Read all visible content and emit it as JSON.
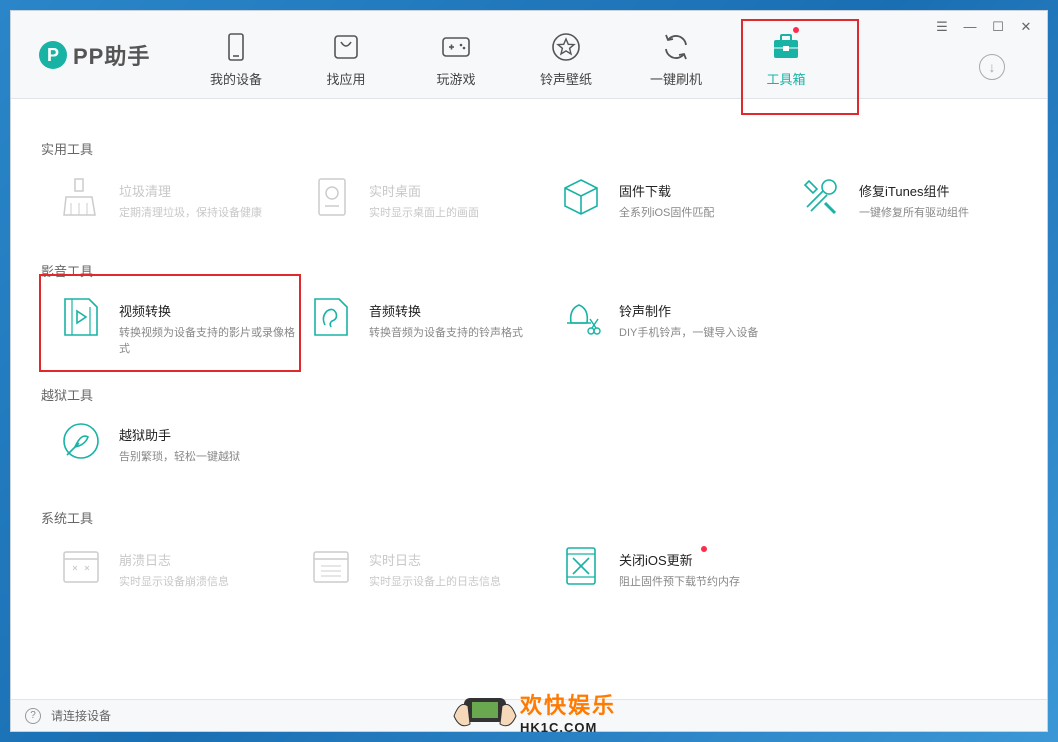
{
  "app": {
    "logo_mark": "P",
    "logo_text": "PP助手"
  },
  "nav": {
    "items": [
      {
        "label": "我的设备",
        "icon": "phone-icon"
      },
      {
        "label": "找应用",
        "icon": "bag-icon"
      },
      {
        "label": "玩游戏",
        "icon": "gamepad-icon"
      },
      {
        "label": "铃声壁纸",
        "icon": "star-icon"
      },
      {
        "label": "一键刷机",
        "icon": "refresh-icon"
      },
      {
        "label": "工具箱",
        "icon": "toolbox-icon",
        "active": true
      }
    ]
  },
  "window_controls": {
    "menu": "☰",
    "minimize": "—",
    "maximize": "☐",
    "close": "✕"
  },
  "download_icon": "↓",
  "sections": {
    "practical": {
      "title": "实用工具",
      "tools": [
        {
          "name": "垃圾清理",
          "desc": "定期清理垃圾，保持设备健康",
          "icon": "brush-icon",
          "disabled": true
        },
        {
          "name": "实时桌面",
          "desc": "实时显示桌面上的画面",
          "icon": "desktop-icon",
          "disabled": true
        },
        {
          "name": "固件下载",
          "desc": "全系列iOS固件匹配",
          "icon": "cube-icon"
        },
        {
          "name": "修复iTunes组件",
          "desc": "一键修复所有驱动组件",
          "icon": "wrench-icon"
        }
      ]
    },
    "media": {
      "title": "影音工具",
      "tools": [
        {
          "name": "视频转换",
          "desc": "转换视频为设备支持的影片或录像格式",
          "icon": "video-file-icon"
        },
        {
          "name": "音频转换",
          "desc": "转换音频为设备支持的铃声格式",
          "icon": "audio-file-icon"
        },
        {
          "name": "铃声制作",
          "desc": "DIY手机铃声，一键导入设备",
          "icon": "bell-scissors-icon"
        }
      ]
    },
    "jailbreak": {
      "title": "越狱工具",
      "tools": [
        {
          "name": "越狱助手",
          "desc": "告别繁琐，轻松一键越狱",
          "icon": "jailbreak-icon"
        }
      ]
    },
    "system": {
      "title": "系统工具",
      "tools": [
        {
          "name": "崩溃日志",
          "desc": "实时显示设备崩溃信息",
          "icon": "crash-log-icon",
          "disabled": true
        },
        {
          "name": "实时日志",
          "desc": "实时显示设备上的日志信息",
          "icon": "log-icon",
          "disabled": true
        },
        {
          "name": "关闭iOS更新",
          "desc": "阻止固件预下载节约内存",
          "icon": "phone-block-icon"
        }
      ]
    }
  },
  "status": {
    "help": "?",
    "text": "请连接设备"
  },
  "watermark": {
    "cn": "欢快娱乐",
    "en": "HK1C.COM"
  },
  "colors": {
    "accent": "#18b3a5",
    "highlight": "#e0292d",
    "badge": "#ff2b4a"
  }
}
